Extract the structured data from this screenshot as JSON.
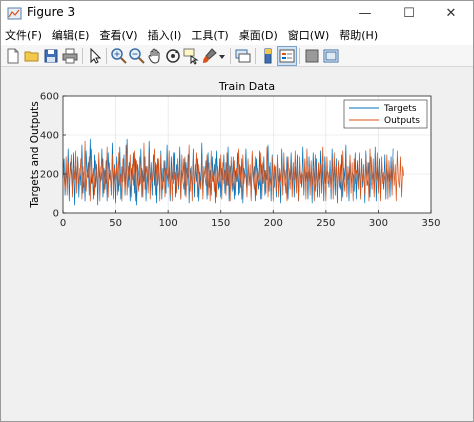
{
  "window": {
    "title": "Figure 3",
    "minimize_glyph": "—",
    "maximize_glyph": "☐",
    "close_glyph": "✕"
  },
  "menu": [
    "文件(F)",
    "编辑(E)",
    "查看(V)",
    "插入(I)",
    "工具(T)",
    "桌面(D)",
    "窗口(W)",
    "帮助(H)"
  ],
  "toolbar": {
    "icons": [
      "new-figure-icon",
      "open-file-icon",
      "save-icon",
      "print-icon",
      "select-arrow-icon",
      "zoom-in-icon",
      "zoom-out-icon",
      "pan-hand-icon",
      "rotate-3d-icon",
      "data-cursor-icon",
      "brush-icon",
      "brush-dropdown-icon",
      "link-plot-icon",
      "insert-colorbar-icon",
      "insert-legend-icon",
      "hide-plot-tools-icon",
      "show-plot-tools-icon"
    ]
  },
  "colors": {
    "targets": "#0072BD",
    "outputs": "#D95319",
    "axes_bg": "#ffffff",
    "figure_bg": "#f0f0f0",
    "grid": "#e0e0e0"
  },
  "chart_data": {
    "type": "line",
    "title": "Train Data",
    "xlabel": "",
    "ylabel": "Targets and Outputs",
    "xlim": [
      0,
      350
    ],
    "ylim": [
      0,
      600
    ],
    "xticks": [
      0,
      50,
      100,
      150,
      200,
      250,
      300,
      350
    ],
    "yticks": [
      0,
      200,
      400,
      600
    ],
    "grid": true,
    "legend_position": "top-right",
    "series": [
      {
        "name": "Targets",
        "values": [
          180,
          280,
          90,
          220,
          150,
          330,
          60,
          260,
          200,
          120,
          310,
          40,
          240,
          170,
          290,
          80,
          230,
          140,
          350,
          100,
          210,
          60,
          320,
          180,
          260,
          90,
          380,
          150,
          200,
          70,
          300,
          130,
          250,
          40,
          280,
          190,
          160,
          330,
          80,
          230,
          120,
          270,
          60,
          310,
          170,
          220,
          90,
          360,
          140,
          250,
          50,
          290,
          180,
          110,
          340,
          70,
          240,
          160,
          300,
          90,
          210,
          380,
          130,
          260,
          60,
          230,
          170,
          310,
          100,
          280,
          40,
          250,
          190,
          140,
          330,
          80,
          220,
          160,
          290,
          60,
          240,
          120,
          370,
          170,
          210,
          90,
          300,
          140,
          260,
          50,
          280,
          190,
          110,
          320,
          70,
          230,
          160,
          270,
          100,
          350,
          130,
          240,
          60,
          290,
          180,
          150,
          310,
          80,
          250,
          200,
          120,
          340,
          70,
          220,
          170,
          280,
          90,
          260,
          140,
          300,
          50,
          230,
          190,
          120,
          330,
          80,
          250,
          160,
          280,
          60,
          210,
          140,
          360,
          100,
          240,
          180,
          270,
          70,
          310,
          130,
          220,
          90,
          290,
          160,
          250,
          50,
          320,
          180,
          120,
          280,
          80,
          230,
          170,
          300,
          100,
          260,
          140,
          340,
          60,
          240,
          190,
          110,
          290,
          70,
          220,
          160,
          310,
          90,
          250,
          130,
          280,
          50,
          230,
          180,
          330,
          100,
          270,
          140,
          210,
          80,
          300,
          160,
          240,
          60,
          280,
          190,
          120,
          320,
          70,
          250,
          150,
          290,
          90,
          220,
          170,
          350,
          110,
          260,
          60,
          300,
          180,
          130,
          240,
          80,
          280,
          160,
          210,
          50,
          330,
          140,
          250,
          190,
          100,
          290,
          70,
          230,
          170,
          310,
          120,
          260,
          80,
          240,
          150,
          300,
          60,
          220,
          190,
          130,
          340,
          90,
          270,
          160,
          210,
          70,
          290,
          140,
          250,
          50,
          310,
          180,
          110,
          280,
          80,
          230,
          170,
          320,
          100,
          250,
          60,
          290,
          150,
          220,
          190,
          130,
          270,
          70,
          330,
          160,
          240,
          90,
          280,
          50,
          260,
          180,
          120,
          300,
          80,
          230,
          170,
          350,
          100,
          240,
          60,
          290,
          140,
          210,
          190,
          110,
          310,
          70,
          270,
          160,
          230,
          90,
          280,
          130,
          250,
          50,
          320,
          180,
          140,
          260,
          80,
          290,
          170,
          210,
          100,
          340,
          60,
          240,
          150,
          280,
          90,
          230,
          190,
          120,
          300,
          70,
          260,
          160,
          220,
          80,
          290,
          140,
          330
        ]
      },
      {
        "name": "Outputs",
        "values": [
          250,
          200,
          120,
          290,
          90,
          260,
          140,
          210,
          300,
          80,
          230,
          170,
          320,
          100,
          260,
          150,
          190,
          280,
          70,
          240,
          130,
          370,
          110,
          210,
          180,
          290,
          60,
          330,
          150,
          230,
          90,
          270,
          190,
          120,
          310,
          60,
          240,
          170,
          280,
          100,
          220,
          150,
          340,
          80,
          260,
          190,
          120,
          300,
          70,
          230,
          170,
          250,
          90,
          310,
          140,
          200,
          60,
          280,
          230,
          120,
          350,
          90,
          240,
          170,
          300,
          80,
          250,
          140,
          320,
          60,
          270,
          190,
          110,
          290,
          150,
          230,
          80,
          360,
          120,
          240,
          190,
          100,
          310,
          70,
          260,
          160,
          220,
          330,
          90,
          250,
          140,
          280,
          60,
          300,
          180,
          120,
          270,
          80,
          230,
          190,
          150,
          320,
          90,
          240,
          60,
          310,
          170,
          210,
          100,
          280,
          140,
          250,
          70,
          300,
          160,
          120,
          290,
          80,
          230,
          180,
          350,
          110,
          240,
          60,
          290,
          150,
          200,
          310,
          80,
          250,
          170,
          120,
          280,
          70,
          230,
          190,
          140,
          300,
          90,
          260,
          60,
          320,
          160,
          210,
          110,
          280,
          80,
          240,
          180,
          130,
          300,
          70,
          260,
          150,
          220,
          90,
          310,
          140,
          250,
          60,
          290,
          180,
          120,
          270,
          90,
          230,
          160,
          330,
          100,
          240,
          70,
          300,
          150,
          210,
          190,
          80,
          280,
          140,
          250,
          60,
          320,
          170,
          120,
          290,
          90,
          230,
          180,
          140,
          310,
          70,
          260,
          150,
          220,
          100,
          340,
          80,
          240,
          170,
          130,
          290,
          60,
          250,
          190,
          110,
          300,
          80,
          230,
          160,
          270,
          90,
          310,
          140,
          220,
          60,
          290,
          180,
          120,
          260,
          80,
          240,
          170,
          320,
          100,
          250,
          60,
          290,
          150,
          210,
          190,
          110,
          280,
          70,
          330,
          160,
          240,
          90,
          270,
          140,
          230,
          60,
          300,
          180,
          120,
          260,
          80,
          250,
          170,
          340,
          100,
          220,
          60,
          290,
          150,
          210,
          190,
          120,
          280,
          70,
          310,
          160,
          240,
          90,
          270,
          130,
          250,
          60,
          320,
          180,
          110,
          290,
          80,
          230,
          170,
          300,
          100,
          260,
          60,
          280,
          150,
          220,
          190,
          120,
          310,
          70,
          250,
          160,
          230,
          90,
          290,
          140,
          260,
          60,
          330,
          180,
          120,
          280,
          80,
          240,
          170,
          310,
          100,
          250,
          60,
          290,
          150,
          210,
          180,
          120,
          300,
          70,
          270,
          160,
          230,
          90,
          280,
          140,
          250,
          60,
          320,
          170,
          130,
          290,
          80,
          240,
          190
        ]
      }
    ]
  }
}
